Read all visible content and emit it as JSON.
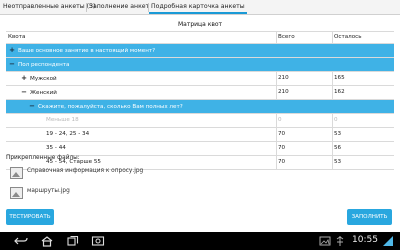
{
  "tabs": [
    {
      "label": "Неотправленные анкеты (5)"
    },
    {
      "label": "Заполнение анкет"
    },
    {
      "label": "Подробная карточка анкеты"
    }
  ],
  "matrix": {
    "title": "Матрица квот",
    "headers": {
      "label": "Квота",
      "total": "Всего",
      "left": "Осталось"
    },
    "rows": [
      {
        "toggle": "+",
        "label": "Ваше основное занятие в настоящий момент?",
        "total": "",
        "left": ""
      },
      {
        "toggle": "−",
        "label": "Пол респондента",
        "total": "",
        "left": ""
      },
      {
        "toggle": "+",
        "label": "Мужской",
        "total": "210",
        "left": "165"
      },
      {
        "toggle": "−",
        "label": "Женский",
        "total": "210",
        "left": "162"
      },
      {
        "toggle": "−",
        "label": "Скажите, пожалуйста, сколько Вам полных лет?",
        "total": "",
        "left": ""
      },
      {
        "toggle": "",
        "label": "Меньше 18",
        "total": "0",
        "left": "0"
      },
      {
        "toggle": "",
        "label": "19 - 24, 25 - 34",
        "total": "70",
        "left": "53"
      },
      {
        "toggle": "",
        "label": "35 - 44",
        "total": "70",
        "left": "56"
      },
      {
        "toggle": "",
        "label": "45 - 54, Старше 55",
        "total": "70",
        "left": "53"
      }
    ]
  },
  "attachments": {
    "label": "Прикрепленные файлы:",
    "files": [
      {
        "name": "Справочная информация к опросу.jpg"
      },
      {
        "name": "маршруты.jpg"
      }
    ]
  },
  "buttons": {
    "test": "ТЕСТИРОВАТЬ",
    "fill": "ЗАПОЛНИТЬ"
  },
  "statusbar": {
    "time": "10:55"
  }
}
